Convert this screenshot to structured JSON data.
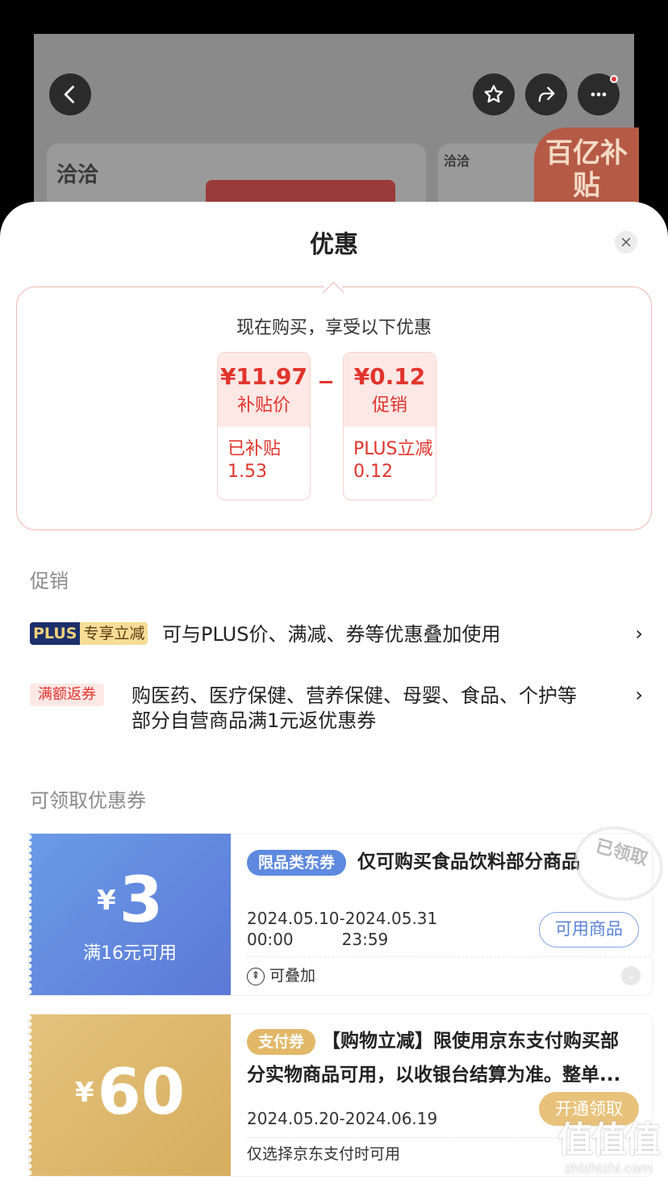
{
  "background": {
    "brand_left": "洽洽",
    "brand_right": "洽洽",
    "badge": "百亿补贴"
  },
  "sheet": {
    "title": "优惠",
    "buy_heading": "现在购买，享受以下优惠",
    "price_boxes": [
      {
        "value": "¥11.97",
        "label": "补贴价",
        "detail_title": "已补贴",
        "detail_value": "1.53"
      },
      {
        "value": "¥0.12",
        "label": "促销",
        "detail_title": "PLUS立减",
        "detail_value": "0.12"
      }
    ]
  },
  "promotions": {
    "section_label": "促销",
    "items": [
      {
        "tag_a": "PLUS",
        "tag_b": "专享立减",
        "text": "可与PLUS价、满减、券等优惠叠加使用"
      },
      {
        "tag": "满额返券",
        "text_line1": "购医药、医疗保健、营养保健、母婴、食品、个护等",
        "text_line2": "部分自营商品满1元返优惠券"
      }
    ]
  },
  "coupons": {
    "section_label": "可领取优惠券",
    "items": [
      {
        "yen": "¥",
        "amount": "3",
        "condition": "满16元可用",
        "tag": "限品类东券",
        "title": "仅可购买食品饮料部分商品",
        "date_start": "2024.05.10",
        "date_sep": "-",
        "date_end": "2024.05.31",
        "time_start": "00:00",
        "time_end": "23:59",
        "button": "可用商品",
        "stack_text": "可叠加",
        "stamp": "已领取"
      },
      {
        "yen": "¥",
        "amount": "60",
        "tag": "支付券",
        "title_line1": "【购物立减】限使用京东支付购买部",
        "title_line2": "分实物商品可用，以收银台结算为准。整单...",
        "date_range": "2024.05.20-2024.06.19",
        "button": "开通领取",
        "note": "仅选择京东支付时可用"
      }
    ]
  },
  "watermark": {
    "big": "值值值",
    "small": "zhizhizhi.com"
  },
  "colors": {
    "accent_red": "#e1342c",
    "plus_navy": "#1d2f6a",
    "plus_gold": "#f6dc95",
    "coupon_blue": "#5c79d6",
    "coupon_gold": "#d7ad5f"
  }
}
